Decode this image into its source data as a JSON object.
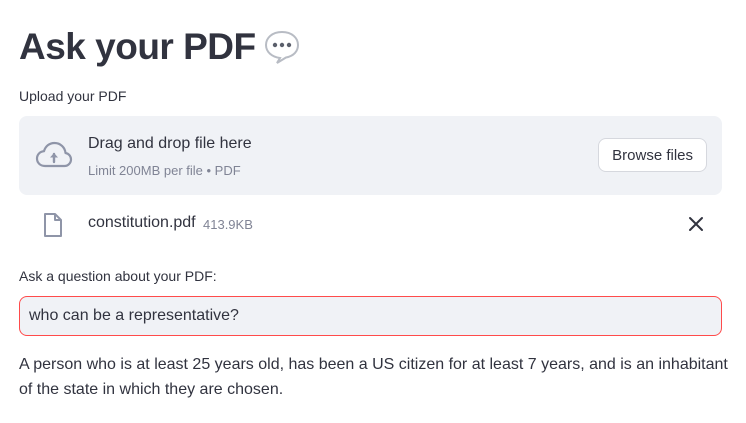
{
  "header": {
    "title": "Ask your PDF",
    "title_emoji": "speech-bubble-emoji"
  },
  "uploader": {
    "label": "Upload your PDF",
    "drop_text": "Drag and drop file here",
    "limit_text": "Limit 200MB per file • PDF",
    "browse_label": "Browse files",
    "icon": "cloud-upload-icon"
  },
  "uploaded_file": {
    "name": "constitution.pdf",
    "size": "413.9KB",
    "icon": "file-icon",
    "remove_icon": "close-icon"
  },
  "question": {
    "label": "Ask a question about your PDF:",
    "value": "who can be a representative?"
  },
  "answer": {
    "text": "A person who is at least 25 years old, has been a US citizen for at least 7 years, and is an inhabitant of the state in which they are chosen."
  },
  "colors": {
    "text": "#31333f",
    "muted": "#808495",
    "panel_bg": "#f0f2f6",
    "accent_border": "#ff4b4b"
  }
}
